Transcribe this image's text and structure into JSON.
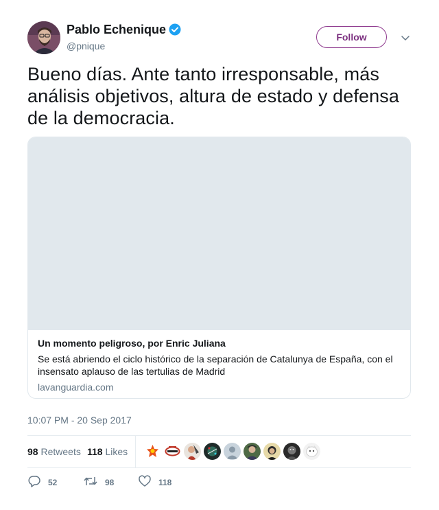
{
  "user": {
    "name": "Pablo Echenique",
    "handle": "@pnique",
    "verified": true,
    "follow_label": "Follow"
  },
  "tweet": {
    "text": "Bueno días. Ante tanto irresponsable, más análisis objetivos, altura de estado y defensa de la democracia.",
    "timestamp": "10:07 PM - 20 Sep 2017"
  },
  "card": {
    "title": "Un momento peligroso, por Enric Juliana",
    "description": "Se está abriendo el ciclo histórico de la separación de Catalunya de España, con el insensato aplauso de las tertulias de Madrid",
    "domain": "lavanguardia.com"
  },
  "stats": {
    "retweets_count": "98",
    "retweets_label": "Retweets",
    "likes_count": "118",
    "likes_label": "Likes"
  },
  "actions": {
    "reply_count": "52",
    "retweet_count": "98",
    "like_count": "118"
  },
  "colors": {
    "accent": "#7b2f7f",
    "verified": "#1da1f2",
    "muted": "#657786",
    "border": "#e6ecf0"
  },
  "icons": [
    "verified-badge-icon",
    "chevron-down-icon",
    "reply-icon",
    "retweet-icon",
    "like-icon"
  ]
}
